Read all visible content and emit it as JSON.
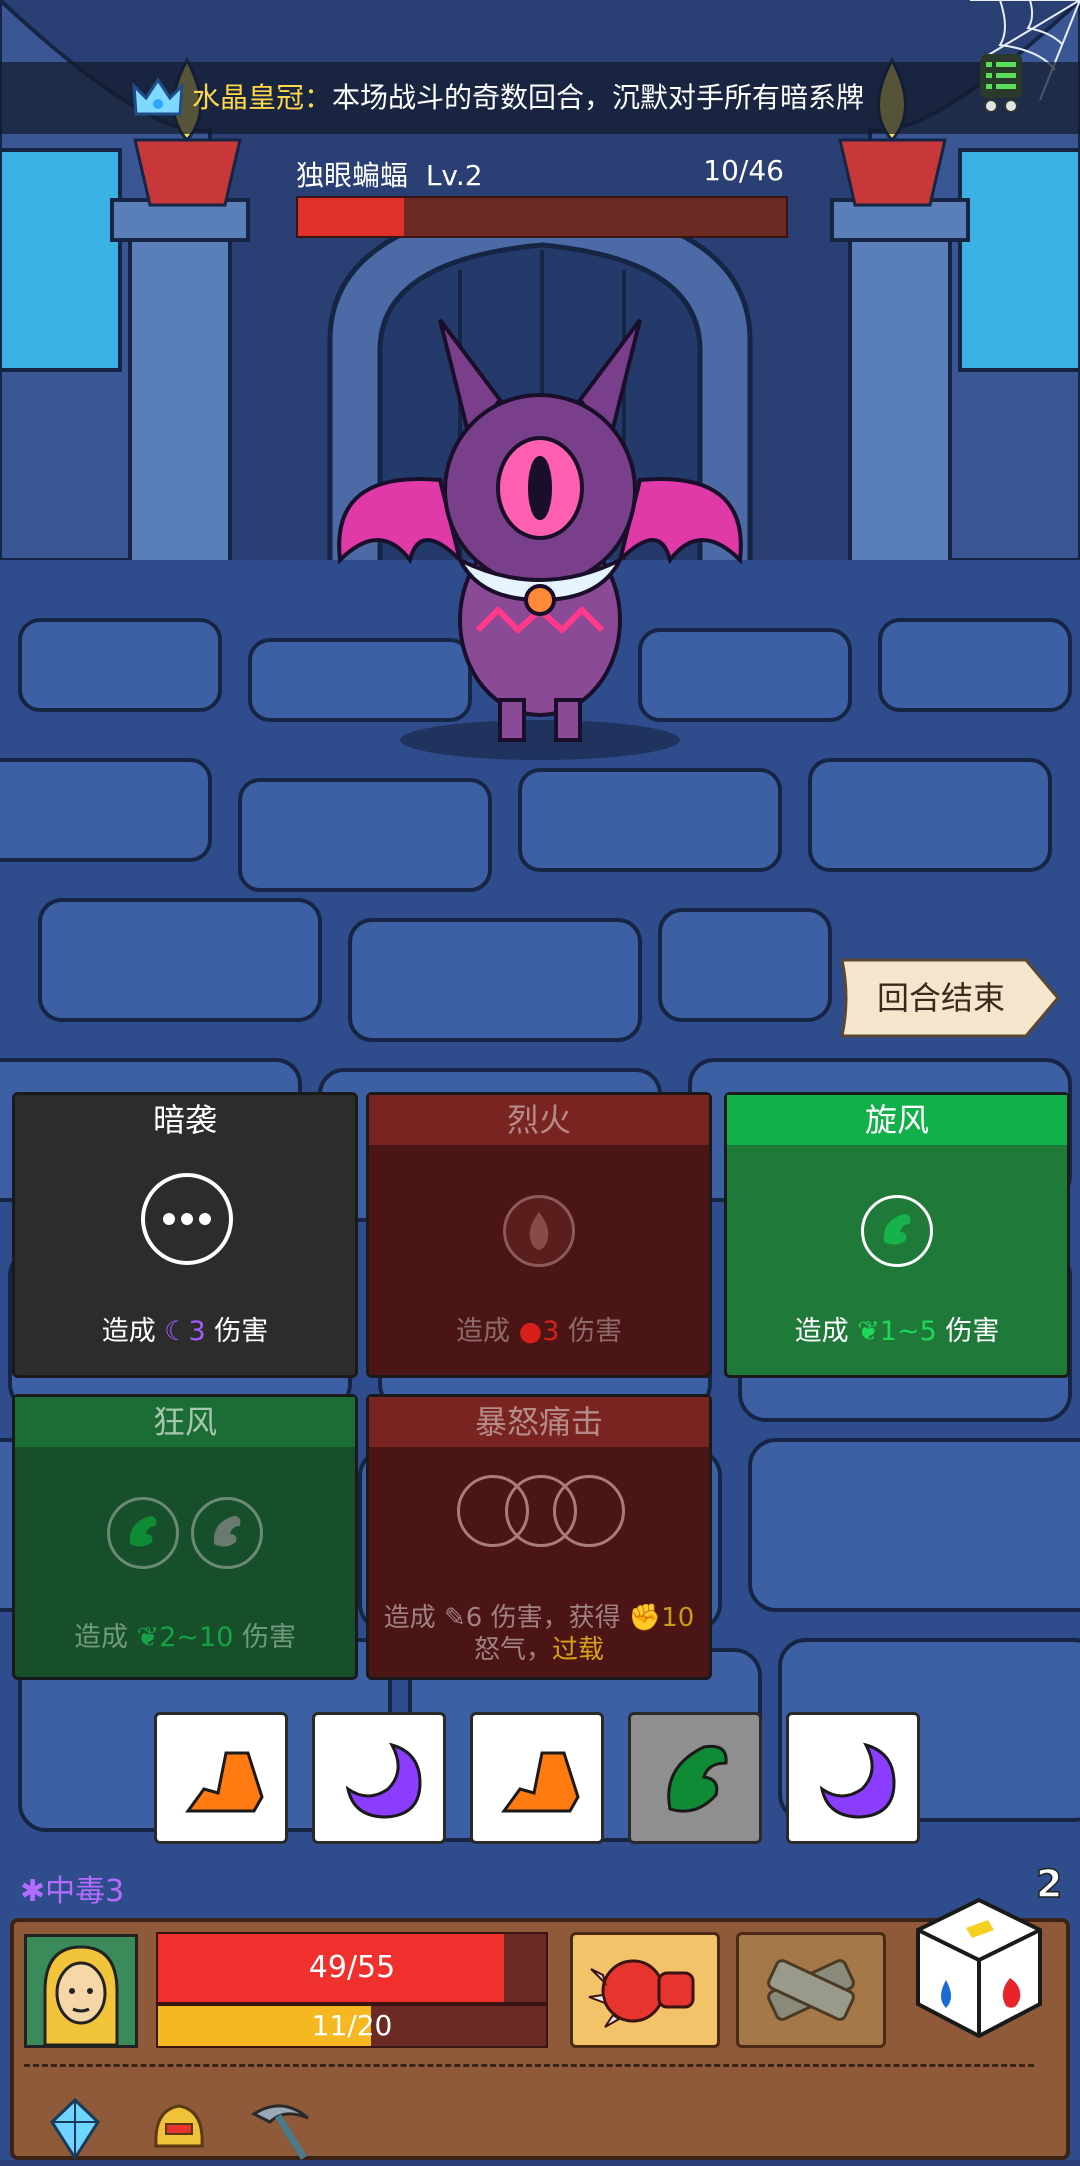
{
  "banner": {
    "relic_name": "水晶皇冠：",
    "relic_effect": "本场战斗的奇数回合，沉默对手所有暗系牌"
  },
  "enemy": {
    "name": "独眼蝙蝠",
    "level": "Lv.2",
    "hp_text": "10/46",
    "hp_fraction": 0.217
  },
  "end_turn_label": "回合结束",
  "cards": [
    {
      "title": "暗袭",
      "style": "dark",
      "desc_prefix": "造成",
      "desc_value": "3",
      "desc_suffix": "伤害",
      "element": "dark"
    },
    {
      "title": "烈火",
      "style": "red",
      "desc_prefix": "造成",
      "desc_value": "3",
      "desc_suffix": "伤害",
      "element": "fire"
    },
    {
      "title": "旋风",
      "style": "green",
      "desc_prefix": "造成",
      "desc_value": "1~5",
      "desc_suffix": "伤害",
      "element": "wind"
    },
    {
      "title": "狂风",
      "style": "dark-green",
      "desc_prefix": "造成",
      "desc_value": "2~10",
      "desc_suffix": "伤害",
      "element": "wind"
    },
    {
      "title": "暴怒痛击",
      "style": "red",
      "desc_line1_prefix": "造成",
      "desc_line1_value": "6",
      "desc_line1_mid": "伤害，获得",
      "desc_line1_value2": "10",
      "desc_line2": "怒气，",
      "desc_line2_highlight": "过载",
      "element": "physical"
    }
  ],
  "dice": [
    {
      "face": "earth",
      "used": false
    },
    {
      "face": "dark",
      "used": false
    },
    {
      "face": "earth",
      "used": false
    },
    {
      "face": "wind",
      "used": true
    },
    {
      "face": "dark",
      "used": false
    }
  ],
  "status": {
    "poison_label": "中毒3",
    "remaining_dice": "2"
  },
  "player": {
    "hp_text": "49/55",
    "hp_fraction": 0.891,
    "rage_text": "11/20",
    "rage_fraction": 0.55
  },
  "skills": [
    {
      "icon": "spiked-fist-icon",
      "active": true
    },
    {
      "icon": "bandage-icon",
      "active": false
    }
  ],
  "relics": [
    "crystal-icon",
    "golden-helmet-icon",
    "pickaxe-icon"
  ],
  "colors": {
    "dark_element": "#8a3cff",
    "fire_element": "#d8201a",
    "wind_element": "#0f8a35",
    "earth_element": "#ff7a10",
    "overload": "#d8a21a"
  }
}
